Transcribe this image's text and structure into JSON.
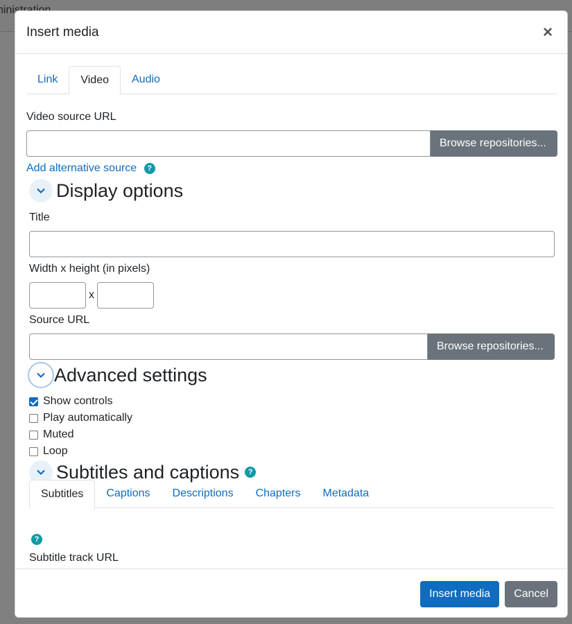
{
  "backdrop": {
    "title_fragment": "Administration"
  },
  "modal": {
    "title": "Insert media",
    "close_label": "×",
    "tabs": [
      {
        "label": "Link",
        "active": false
      },
      {
        "label": "Video",
        "active": true
      },
      {
        "label": "Audio",
        "active": false
      }
    ],
    "video_source_label": "Video source URL",
    "video_source_value": "",
    "browse_label": "Browse repositories...",
    "add_alternative_label": "Add alternative source",
    "help_glyph": "?",
    "display_options": {
      "heading": "Display options",
      "title_label": "Title",
      "title_value": "",
      "size_label": "Width x height (in pixels)",
      "size_separator": "x",
      "width_value": "",
      "height_value": "",
      "source_url_label": "Source URL",
      "source_url_value": ""
    },
    "advanced_settings": {
      "heading": "Advanced settings",
      "options": [
        {
          "label": "Show controls",
          "checked": true
        },
        {
          "label": "Play automatically",
          "checked": false
        },
        {
          "label": "Muted",
          "checked": false
        },
        {
          "label": "Loop",
          "checked": false
        }
      ]
    },
    "subtitles": {
      "heading": "Subtitles and captions",
      "tabs": [
        {
          "label": "Subtitles",
          "active": true
        },
        {
          "label": "Captions",
          "active": false
        },
        {
          "label": "Descriptions",
          "active": false
        },
        {
          "label": "Chapters",
          "active": false
        },
        {
          "label": "Metadata",
          "active": false
        }
      ],
      "track_url_label": "Subtitle track URL"
    },
    "footer": {
      "insert_label": "Insert media",
      "cancel_label": "Cancel"
    }
  },
  "colors": {
    "link": "#0f6cbf",
    "primary": "#0f6cbf",
    "secondary": "#6a737b",
    "help": "#0f9aa6"
  }
}
